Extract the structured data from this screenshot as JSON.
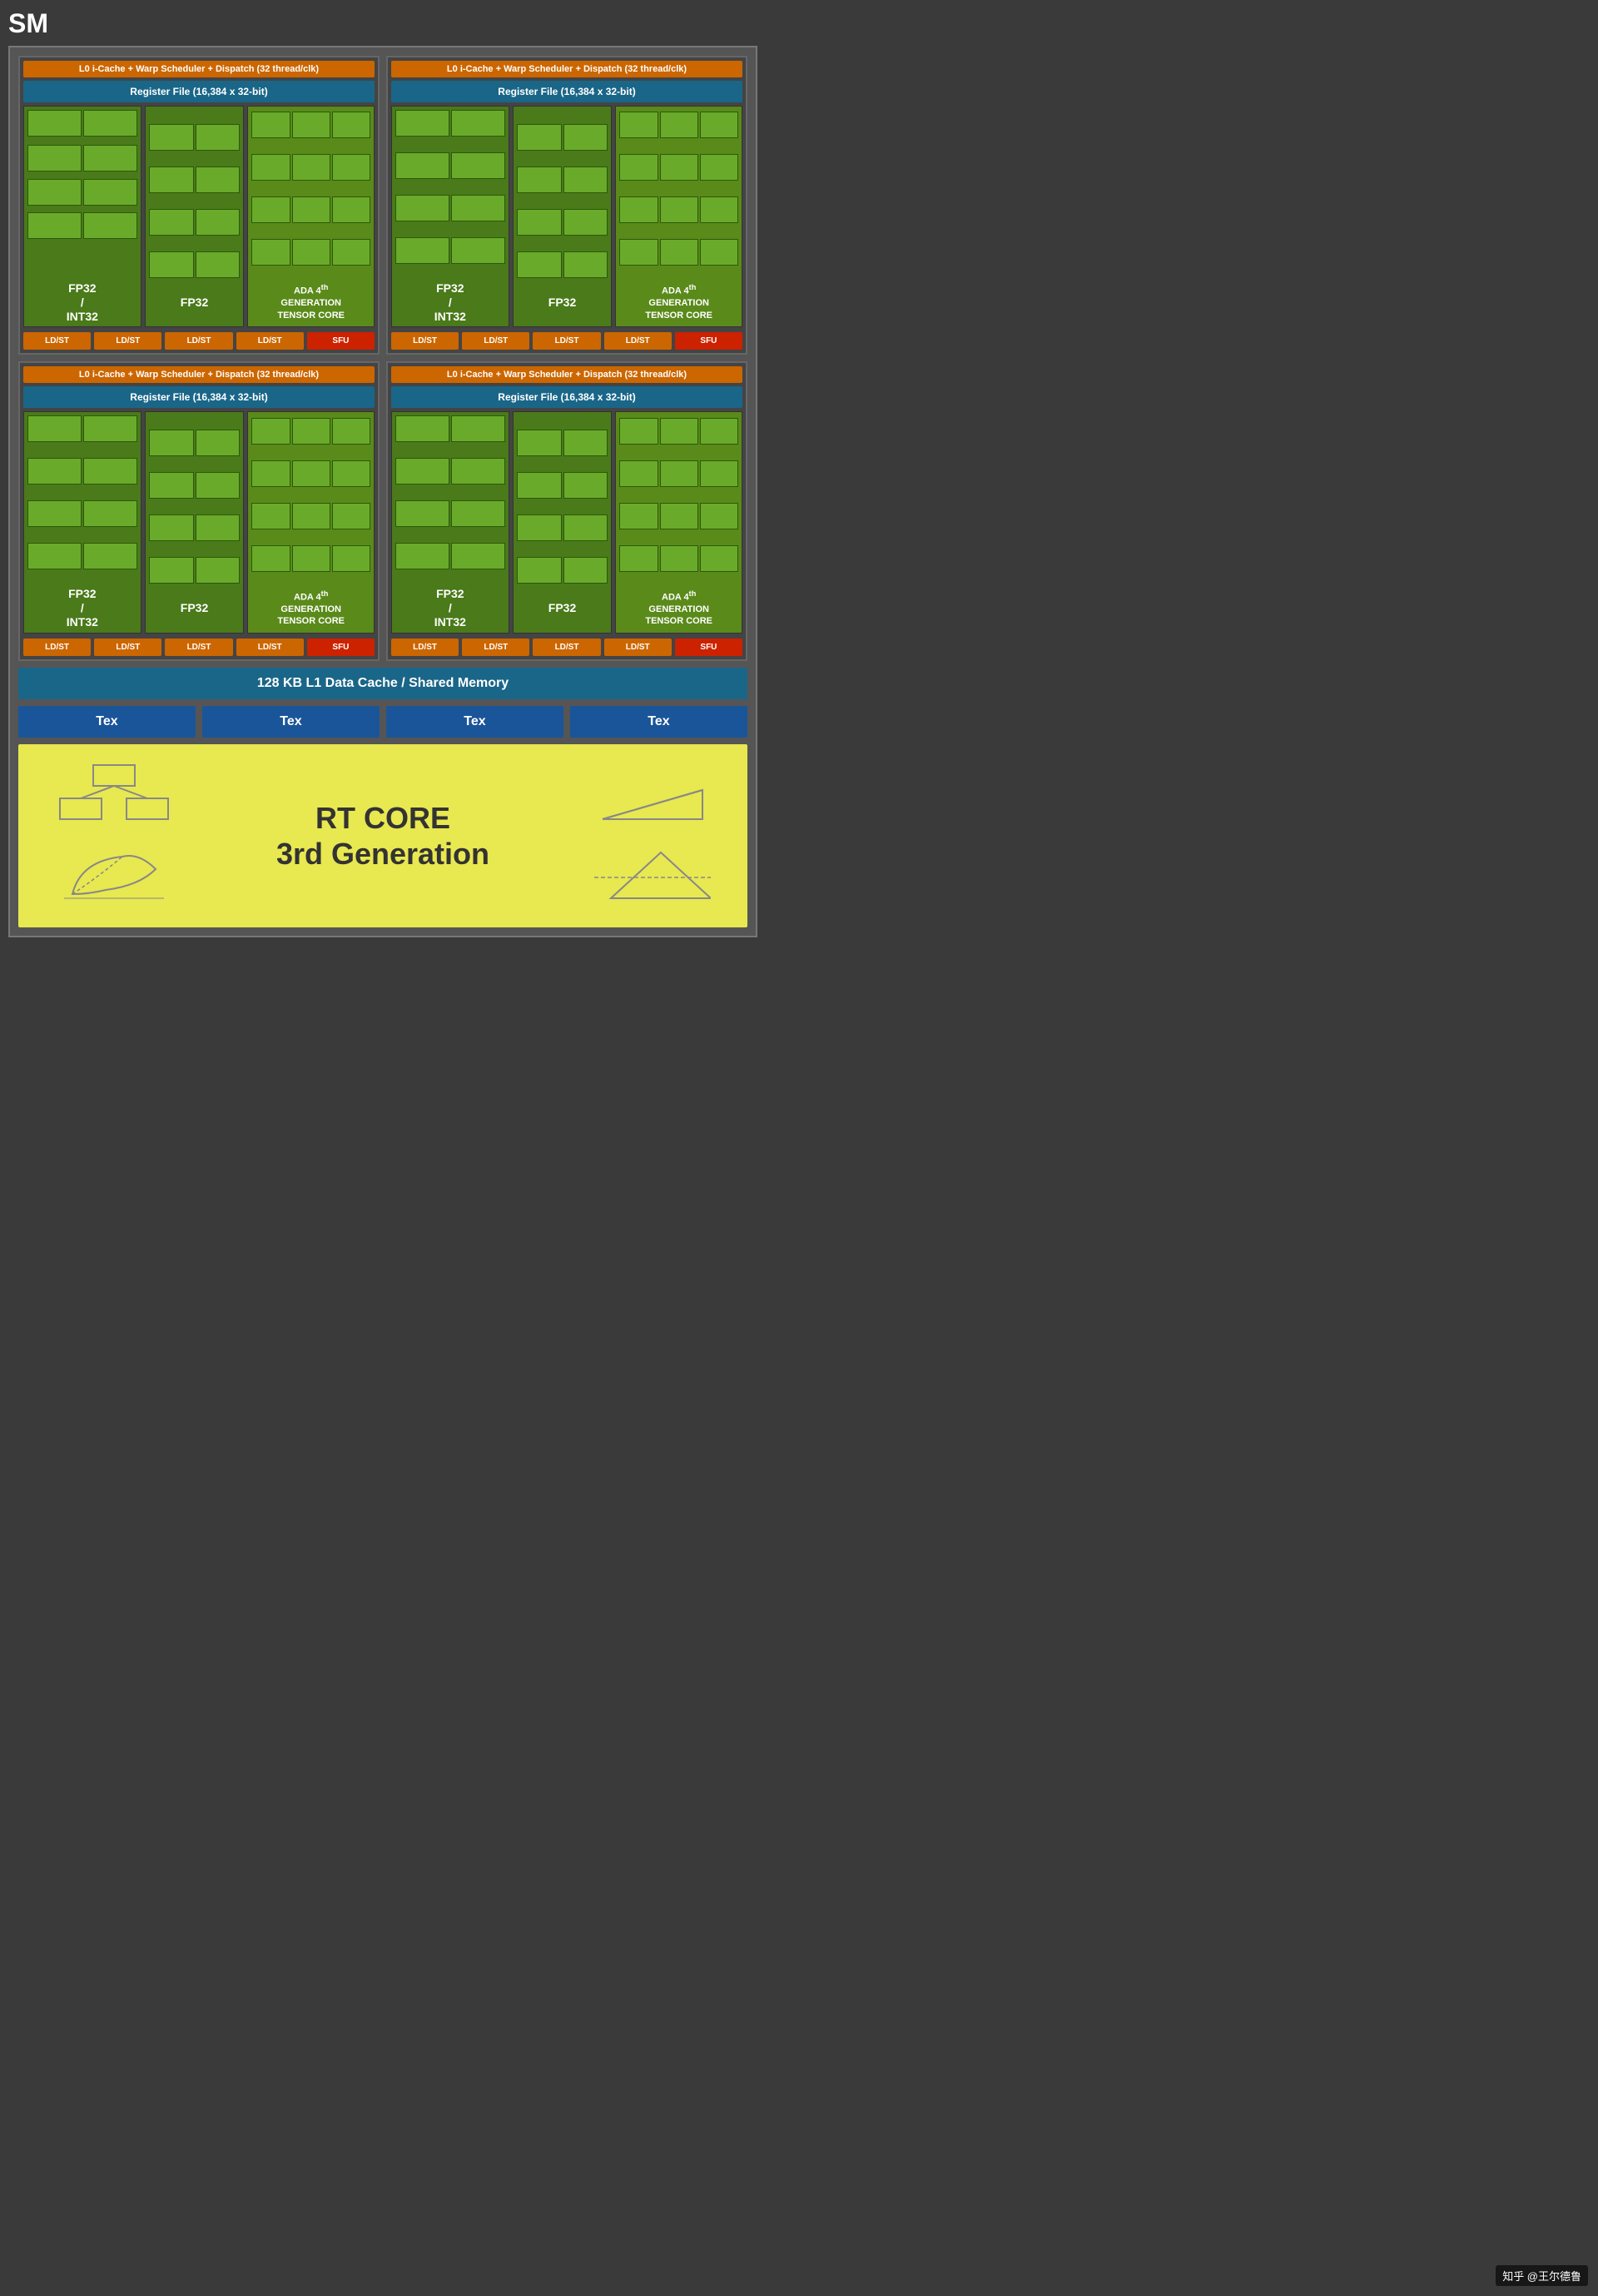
{
  "title": "SM",
  "units": [
    {
      "id": "unit-top-left",
      "warp_label": "L0 i-Cache + Warp Scheduler + Dispatch (32 thread/clk)",
      "register_label": "Register File (16,384 x 32-bit)",
      "fp32_int32_label": "FP32\n/\nINT32",
      "fp32_label": "FP32",
      "tensor_label": "ADA 4th GENERATION TENSOR CORE",
      "ldst_labels": [
        "LD/ST",
        "LD/ST",
        "LD/ST",
        "LD/ST"
      ],
      "sfu_label": "SFU"
    },
    {
      "id": "unit-top-right",
      "warp_label": "L0 i-Cache + Warp Scheduler + Dispatch (32 thread/clk)",
      "register_label": "Register File (16,384 x 32-bit)",
      "fp32_int32_label": "FP32\n/\nINT32",
      "fp32_label": "FP32",
      "tensor_label": "ADA 4th GENERATION TENSOR CORE",
      "ldst_labels": [
        "LD/ST",
        "LD/ST",
        "LD/ST",
        "LD/ST"
      ],
      "sfu_label": "SFU"
    },
    {
      "id": "unit-bottom-left",
      "warp_label": "L0 i-Cache + Warp Scheduler + Dispatch (32 thread/clk)",
      "register_label": "Register File (16,384 x 32-bit)",
      "fp32_int32_label": "FP32\n/\nINT32",
      "fp32_label": "FP32",
      "tensor_label": "ADA 4th GENERATION TENSOR CORE",
      "ldst_labels": [
        "LD/ST",
        "LD/ST",
        "LD/ST",
        "LD/ST"
      ],
      "sfu_label": "SFU"
    },
    {
      "id": "unit-bottom-right",
      "warp_label": "L0 i-Cache + Warp Scheduler + Dispatch (32 thread/clk)",
      "register_label": "Register File (16,384 x 32-bit)",
      "fp32_int32_label": "FP32\n/\nINT32",
      "fp32_label": "FP32",
      "tensor_label": "ADA 4th GENERATION TENSOR CORE",
      "ldst_labels": [
        "LD/ST",
        "LD/ST",
        "LD/ST",
        "LD/ST"
      ],
      "sfu_label": "SFU"
    }
  ],
  "l1_cache_label": "128 KB L1 Data Cache / Shared Memory",
  "tex_labels": [
    "Tex",
    "Tex",
    "Tex",
    "Tex"
  ],
  "rt_core_title": "RT CORE",
  "rt_core_subtitle": "3rd Generation",
  "watermark": "知乎 @王尔德鲁"
}
